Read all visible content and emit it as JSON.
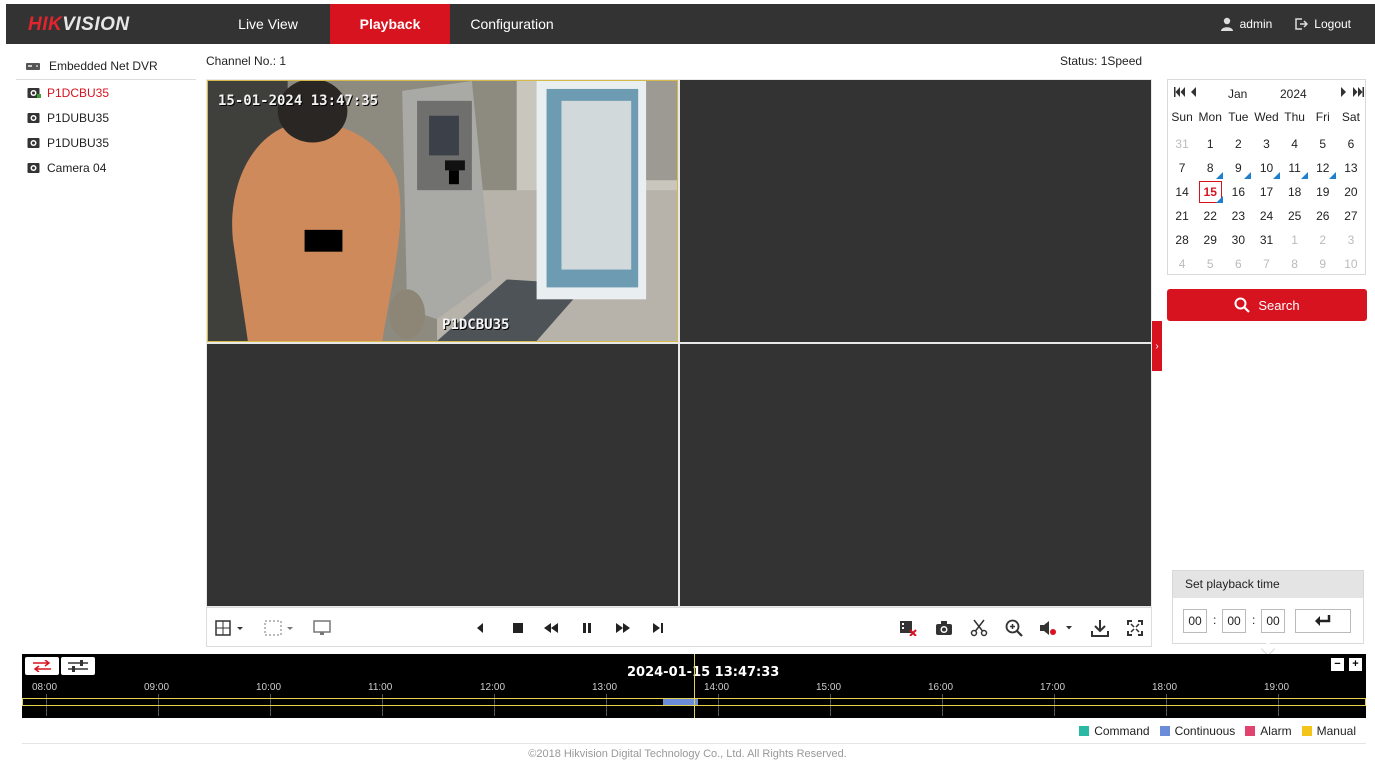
{
  "header": {
    "logo_brand": "HIK",
    "logo_rest": "VISION",
    "tabs": [
      "Live View",
      "Playback",
      "Configuration"
    ],
    "active_tab": "Playback",
    "user": "admin",
    "logout": "Logout"
  },
  "device": {
    "name": "Embedded Net DVR",
    "cameras": [
      {
        "name": "P1DCBU35",
        "active": true
      },
      {
        "name": "P1DUBU35",
        "active": false
      },
      {
        "name": "P1DUBU35",
        "active": false
      },
      {
        "name": "Camera 04",
        "active": false
      }
    ]
  },
  "status": {
    "channel": "Channel No.: 1",
    "speed": "Status: 1Speed"
  },
  "video": {
    "osd_time": "15-01-2024 13:47:35",
    "osd_name": "P1DCBU35"
  },
  "calendar": {
    "month": "Jan",
    "year": "2024",
    "weekdays": [
      "Sun",
      "Mon",
      "Tue",
      "Wed",
      "Thu",
      "Fri",
      "Sat"
    ],
    "weeks": [
      [
        "31",
        "1",
        "2",
        "3",
        "4",
        "5",
        "6"
      ],
      [
        "7",
        "8",
        "9",
        "10",
        "11",
        "12",
        "13"
      ],
      [
        "14",
        "15",
        "16",
        "17",
        "18",
        "19",
        "20"
      ],
      [
        "21",
        "22",
        "23",
        "24",
        "25",
        "26",
        "27"
      ],
      [
        "28",
        "29",
        "30",
        "31",
        "1",
        "2",
        "3"
      ],
      [
        "4",
        "5",
        "6",
        "7",
        "8",
        "9",
        "10"
      ]
    ],
    "selected_day": "15",
    "days_with_records": [
      "8",
      "9",
      "10",
      "11",
      "12",
      "15"
    ]
  },
  "search": {
    "label": "Search"
  },
  "playback_time": {
    "title": "Set playback time",
    "hour": "00",
    "minute": "00",
    "second": "00"
  },
  "timeline": {
    "current": "2024-01-15 13:47:33",
    "labels": [
      "08:00",
      "09:00",
      "10:00",
      "11:00",
      "12:00",
      "13:00",
      "14:00",
      "15:00",
      "16:00",
      "17:00",
      "18:00",
      "19:00"
    ]
  },
  "legend": [
    {
      "label": "Command",
      "color": "#2bb9a4"
    },
    {
      "label": "Continuous",
      "color": "#6b8cd8"
    },
    {
      "label": "Alarm",
      "color": "#e0436e"
    },
    {
      "label": "Manual",
      "color": "#f2c518"
    }
  ],
  "footer": "©2018 Hikvision Digital Technology Co., Ltd. All Rights Reserved."
}
